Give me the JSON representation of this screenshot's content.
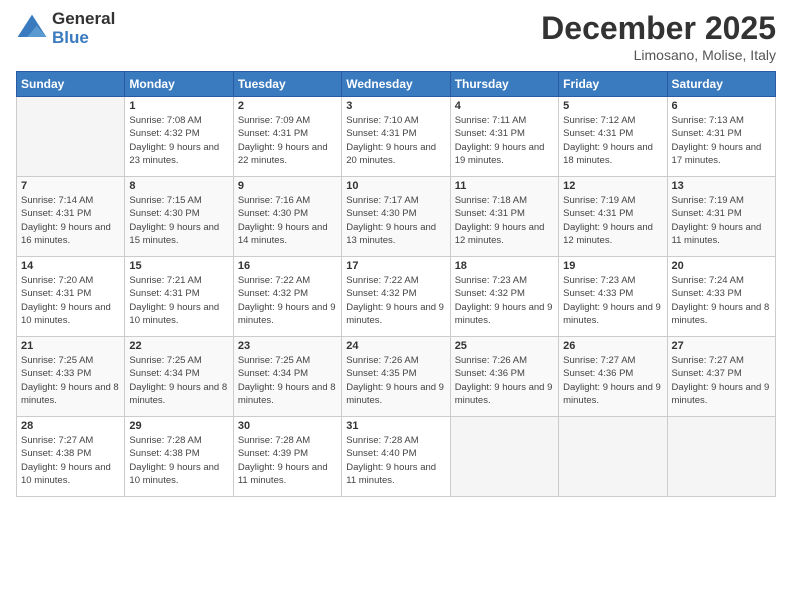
{
  "logo": {
    "line1": "General",
    "line2": "Blue"
  },
  "title": "December 2025",
  "subtitle": "Limosano, Molise, Italy",
  "headers": [
    "Sunday",
    "Monday",
    "Tuesday",
    "Wednesday",
    "Thursday",
    "Friday",
    "Saturday"
  ],
  "weeks": [
    [
      {
        "day": "",
        "sunrise": "",
        "sunset": "",
        "daylight": ""
      },
      {
        "day": "1",
        "sunrise": "Sunrise: 7:08 AM",
        "sunset": "Sunset: 4:32 PM",
        "daylight": "Daylight: 9 hours and 23 minutes."
      },
      {
        "day": "2",
        "sunrise": "Sunrise: 7:09 AM",
        "sunset": "Sunset: 4:31 PM",
        "daylight": "Daylight: 9 hours and 22 minutes."
      },
      {
        "day": "3",
        "sunrise": "Sunrise: 7:10 AM",
        "sunset": "Sunset: 4:31 PM",
        "daylight": "Daylight: 9 hours and 20 minutes."
      },
      {
        "day": "4",
        "sunrise": "Sunrise: 7:11 AM",
        "sunset": "Sunset: 4:31 PM",
        "daylight": "Daylight: 9 hours and 19 minutes."
      },
      {
        "day": "5",
        "sunrise": "Sunrise: 7:12 AM",
        "sunset": "Sunset: 4:31 PM",
        "daylight": "Daylight: 9 hours and 18 minutes."
      },
      {
        "day": "6",
        "sunrise": "Sunrise: 7:13 AM",
        "sunset": "Sunset: 4:31 PM",
        "daylight": "Daylight: 9 hours and 17 minutes."
      }
    ],
    [
      {
        "day": "7",
        "sunrise": "Sunrise: 7:14 AM",
        "sunset": "Sunset: 4:31 PM",
        "daylight": "Daylight: 9 hours and 16 minutes."
      },
      {
        "day": "8",
        "sunrise": "Sunrise: 7:15 AM",
        "sunset": "Sunset: 4:30 PM",
        "daylight": "Daylight: 9 hours and 15 minutes."
      },
      {
        "day": "9",
        "sunrise": "Sunrise: 7:16 AM",
        "sunset": "Sunset: 4:30 PM",
        "daylight": "Daylight: 9 hours and 14 minutes."
      },
      {
        "day": "10",
        "sunrise": "Sunrise: 7:17 AM",
        "sunset": "Sunset: 4:30 PM",
        "daylight": "Daylight: 9 hours and 13 minutes."
      },
      {
        "day": "11",
        "sunrise": "Sunrise: 7:18 AM",
        "sunset": "Sunset: 4:31 PM",
        "daylight": "Daylight: 9 hours and 12 minutes."
      },
      {
        "day": "12",
        "sunrise": "Sunrise: 7:19 AM",
        "sunset": "Sunset: 4:31 PM",
        "daylight": "Daylight: 9 hours and 12 minutes."
      },
      {
        "day": "13",
        "sunrise": "Sunrise: 7:19 AM",
        "sunset": "Sunset: 4:31 PM",
        "daylight": "Daylight: 9 hours and 11 minutes."
      }
    ],
    [
      {
        "day": "14",
        "sunrise": "Sunrise: 7:20 AM",
        "sunset": "Sunset: 4:31 PM",
        "daylight": "Daylight: 9 hours and 10 minutes."
      },
      {
        "day": "15",
        "sunrise": "Sunrise: 7:21 AM",
        "sunset": "Sunset: 4:31 PM",
        "daylight": "Daylight: 9 hours and 10 minutes."
      },
      {
        "day": "16",
        "sunrise": "Sunrise: 7:22 AM",
        "sunset": "Sunset: 4:32 PM",
        "daylight": "Daylight: 9 hours and 9 minutes."
      },
      {
        "day": "17",
        "sunrise": "Sunrise: 7:22 AM",
        "sunset": "Sunset: 4:32 PM",
        "daylight": "Daylight: 9 hours and 9 minutes."
      },
      {
        "day": "18",
        "sunrise": "Sunrise: 7:23 AM",
        "sunset": "Sunset: 4:32 PM",
        "daylight": "Daylight: 9 hours and 9 minutes."
      },
      {
        "day": "19",
        "sunrise": "Sunrise: 7:23 AM",
        "sunset": "Sunset: 4:33 PM",
        "daylight": "Daylight: 9 hours and 9 minutes."
      },
      {
        "day": "20",
        "sunrise": "Sunrise: 7:24 AM",
        "sunset": "Sunset: 4:33 PM",
        "daylight": "Daylight: 9 hours and 8 minutes."
      }
    ],
    [
      {
        "day": "21",
        "sunrise": "Sunrise: 7:25 AM",
        "sunset": "Sunset: 4:33 PM",
        "daylight": "Daylight: 9 hours and 8 minutes."
      },
      {
        "day": "22",
        "sunrise": "Sunrise: 7:25 AM",
        "sunset": "Sunset: 4:34 PM",
        "daylight": "Daylight: 9 hours and 8 minutes."
      },
      {
        "day": "23",
        "sunrise": "Sunrise: 7:25 AM",
        "sunset": "Sunset: 4:34 PM",
        "daylight": "Daylight: 9 hours and 8 minutes."
      },
      {
        "day": "24",
        "sunrise": "Sunrise: 7:26 AM",
        "sunset": "Sunset: 4:35 PM",
        "daylight": "Daylight: 9 hours and 9 minutes."
      },
      {
        "day": "25",
        "sunrise": "Sunrise: 7:26 AM",
        "sunset": "Sunset: 4:36 PM",
        "daylight": "Daylight: 9 hours and 9 minutes."
      },
      {
        "day": "26",
        "sunrise": "Sunrise: 7:27 AM",
        "sunset": "Sunset: 4:36 PM",
        "daylight": "Daylight: 9 hours and 9 minutes."
      },
      {
        "day": "27",
        "sunrise": "Sunrise: 7:27 AM",
        "sunset": "Sunset: 4:37 PM",
        "daylight": "Daylight: 9 hours and 9 minutes."
      }
    ],
    [
      {
        "day": "28",
        "sunrise": "Sunrise: 7:27 AM",
        "sunset": "Sunset: 4:38 PM",
        "daylight": "Daylight: 9 hours and 10 minutes."
      },
      {
        "day": "29",
        "sunrise": "Sunrise: 7:28 AM",
        "sunset": "Sunset: 4:38 PM",
        "daylight": "Daylight: 9 hours and 10 minutes."
      },
      {
        "day": "30",
        "sunrise": "Sunrise: 7:28 AM",
        "sunset": "Sunset: 4:39 PM",
        "daylight": "Daylight: 9 hours and 11 minutes."
      },
      {
        "day": "31",
        "sunrise": "Sunrise: 7:28 AM",
        "sunset": "Sunset: 4:40 PM",
        "daylight": "Daylight: 9 hours and 11 minutes."
      },
      {
        "day": "",
        "sunrise": "",
        "sunset": "",
        "daylight": ""
      },
      {
        "day": "",
        "sunrise": "",
        "sunset": "",
        "daylight": ""
      },
      {
        "day": "",
        "sunrise": "",
        "sunset": "",
        "daylight": ""
      }
    ]
  ]
}
